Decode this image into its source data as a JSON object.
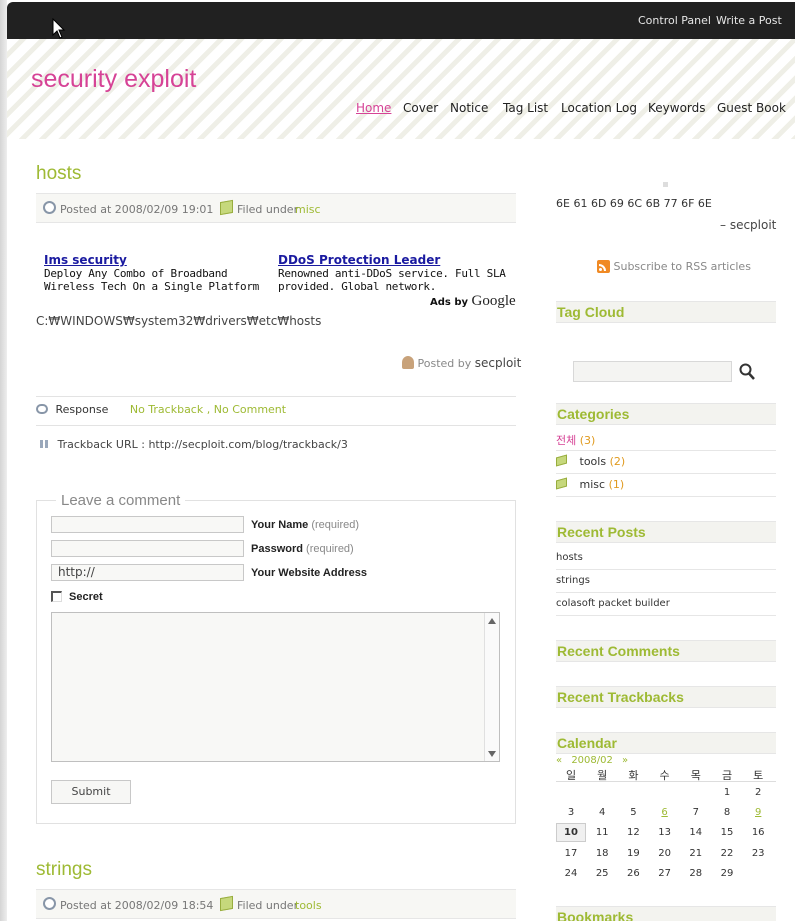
{
  "topbar": {
    "control_panel": "Control Panel",
    "write_post": "Write a Post"
  },
  "blog": {
    "title": "security exploit"
  },
  "nav": {
    "items": [
      "Home",
      "Cover",
      "Notice",
      "Tag List",
      "Location Log",
      "Keywords",
      "Guest Book"
    ],
    "active": "Home"
  },
  "post1": {
    "title": "hosts",
    "posted_at": "Posted at 2008/02/09 19:01",
    "filed_under": "Filed under",
    "category": "misc",
    "ads": [
      {
        "title": "Ims security",
        "line1": "Deploy Any Combo of Broadband",
        "line2": "Wireless Tech On a Single Platform"
      },
      {
        "title": "DDoS Protection Leader",
        "line1": "Renowned anti-DDoS service. Full SLA",
        "line2": "provided. Global network."
      }
    ],
    "ads_by": "Ads by",
    "ads_brand": "Google",
    "body": "C:₩WINDOWS₩system32₩drivers₩etc₩hosts",
    "posted_by_label": "Posted by",
    "author": "secploit",
    "response_label": "Response",
    "trackback_link": "No Trackback",
    "separator": ",",
    "comment_link": "No Comment",
    "trackback_url": "Trackback URL : http://secploit.com/blog/trackback/3"
  },
  "comment_form": {
    "legend": "Leave a comment",
    "name_label": "Your Name",
    "password_label": "Password",
    "required": "(required)",
    "website_label": "Your Website Address",
    "website_value": "http://",
    "secret_label": "Secret",
    "submit_label": "Submit"
  },
  "post2": {
    "title": "strings",
    "posted_at": "Posted at 2008/02/09 18:54",
    "filed_under": "Filed under",
    "category": "tools"
  },
  "sidebar": {
    "hex_text": "6E 61 6D 69 6C 6B 77 6F 6E",
    "signature": "– secploit",
    "rss_label": "Subscribe to RSS articles",
    "tag_cloud_title": "Tag Cloud",
    "categories_title": "Categories",
    "categories": [
      {
        "name": "전체",
        "count": "(3)"
      },
      {
        "name": "tools",
        "count": "(2)"
      },
      {
        "name": "misc",
        "count": "(1)"
      }
    ],
    "recent_posts_title": "Recent Posts",
    "recent_posts": [
      "hosts",
      "strings",
      "colasoft packet builder"
    ],
    "recent_comments_title": "Recent Comments",
    "recent_trackbacks_title": "Recent Trackbacks",
    "calendar_title": "Calendar",
    "calendar_prev": "«",
    "calendar_month": "2008/02",
    "calendar_next": "»",
    "weekdays": [
      "일",
      "월",
      "화",
      "수",
      "목",
      "금",
      "토"
    ],
    "weeks": [
      [
        "",
        "",
        "",
        "",
        "",
        "1",
        "2"
      ],
      [
        "3",
        "4",
        "5",
        "6",
        "7",
        "8",
        "9"
      ],
      [
        "10",
        "11",
        "12",
        "13",
        "14",
        "15",
        "16"
      ],
      [
        "17",
        "18",
        "19",
        "20",
        "21",
        "22",
        "23"
      ],
      [
        "24",
        "25",
        "26",
        "27",
        "28",
        "29",
        ""
      ]
    ],
    "linked_days": [
      "6",
      "9"
    ],
    "today": "10",
    "bookmarks_title": "Bookmarks"
  },
  "colors": {
    "accent_pink": "#d64396",
    "accent_green": "#9eba34",
    "topbar": "#212121"
  }
}
